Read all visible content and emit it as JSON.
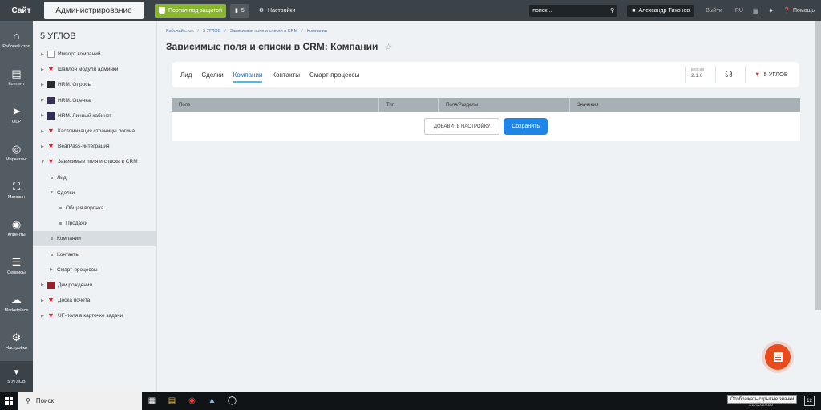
{
  "topbar": {
    "site": "Сайт",
    "admin": "Администрирование",
    "protect": "Портал под защитой",
    "notif_count": "5",
    "settings": "Настройки",
    "search_placeholder": "поиск...",
    "user": "Александр Тихонов",
    "logout": "Выйти",
    "lang": "RU",
    "help": "Помощь"
  },
  "leftnav": [
    {
      "label": "Рабочий стол",
      "icon": "home-icon"
    },
    {
      "label": "Контент",
      "icon": "document-icon"
    },
    {
      "label": "OLP",
      "icon": "arrow-circle-icon"
    },
    {
      "label": "Маркетинг",
      "icon": "target-icon"
    },
    {
      "label": "Магазин",
      "icon": "basket-icon"
    },
    {
      "label": "Клиенты",
      "icon": "clients-icon"
    },
    {
      "label": "Сервисы",
      "icon": "layers-icon"
    },
    {
      "label": "Marketplace",
      "icon": "cloud-icon"
    },
    {
      "label": "Настройки",
      "icon": "gear-icon"
    }
  ],
  "leftnav_bottom": "5 УГЛОВ",
  "sidebar": {
    "title": "5 УГЛОВ",
    "items": [
      {
        "label": "Импорт компаний",
        "level": 0,
        "icon": "file-icon",
        "arrow": "right"
      },
      {
        "label": "Шаблон модуля админки",
        "level": 0,
        "icon": "brand-icon",
        "arrow": "right"
      },
      {
        "label": "HRM. Опросы",
        "level": 0,
        "icon": "hrm-poll-icon",
        "arrow": "right"
      },
      {
        "label": "HRM. Оценка",
        "level": 0,
        "icon": "hrm-rating-icon",
        "arrow": "right"
      },
      {
        "label": "HRM. Личный кабинет",
        "level": 0,
        "icon": "hrm-cabinet-icon",
        "arrow": "right"
      },
      {
        "label": "Кастомизация страницы логина",
        "level": 0,
        "icon": "brand-icon",
        "arrow": "right"
      },
      {
        "label": "BearPass-интеграция",
        "level": 0,
        "icon": "brand-icon",
        "arrow": "right"
      },
      {
        "label": "Зависимые поля и списки в CRM",
        "level": 0,
        "icon": "brand-icon",
        "arrow": "down"
      },
      {
        "label": "Лид",
        "level": 1,
        "arrow": "none"
      },
      {
        "label": "Сделки",
        "level": 1,
        "arrow": "down"
      },
      {
        "label": "Общая воронка",
        "level": 2,
        "arrow": "none"
      },
      {
        "label": "Продажи",
        "level": 2,
        "arrow": "none"
      },
      {
        "label": "Компании",
        "level": 1,
        "arrow": "none",
        "active": true
      },
      {
        "label": "Контакты",
        "level": 1,
        "arrow": "none"
      },
      {
        "label": "Смарт-процессы",
        "level": 1,
        "arrow": "right"
      },
      {
        "label": "Дни рождения",
        "level": 0,
        "icon": "birthday-icon",
        "arrow": "right"
      },
      {
        "label": "Доска почёта",
        "level": 0,
        "icon": "brand-icon",
        "arrow": "right"
      },
      {
        "label": "UF-поля в карточке задачи",
        "level": 0,
        "icon": "brand-icon",
        "arrow": "right"
      }
    ]
  },
  "breadcrumbs": [
    "Рабочий стол",
    "5 УГЛОВ",
    "Зависимые поля и списки в CRM",
    "Компании"
  ],
  "page_title": "Зависимые поля и списки в CRM: Компании",
  "tabs": [
    "Лид",
    "Сделки",
    "Компании",
    "Контакты",
    "Смарт-процессы"
  ],
  "active_tab": "Компании",
  "version_label": "версия",
  "version": "2.1.0",
  "brand": "5 УГЛОВ",
  "table": {
    "headers": [
      "Поле",
      "Тип",
      "Поля/Разделы",
      "Значения"
    ],
    "add_button": "ДОБАВИТЬ НАСТРОЙКУ",
    "save_button": "Сохранить"
  },
  "taskbar": {
    "search": "Поиск",
    "tooltip": "Отображать скрытые значки",
    "date": "22.05.2026",
    "notif": "12"
  },
  "colors": {
    "accent": "#1d86e6",
    "brand": "#d8262f",
    "topbar": "#3b4248",
    "protect": "#8ab62f",
    "fab": "#e84c1c"
  }
}
